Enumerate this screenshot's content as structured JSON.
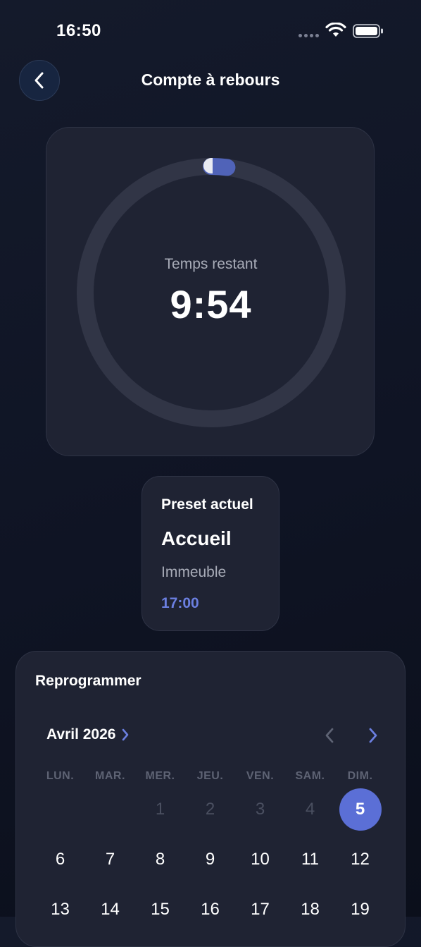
{
  "status_bar": {
    "time": "16:50"
  },
  "nav": {
    "title": "Compte à rebours"
  },
  "timer": {
    "label": "Temps restant",
    "value": "9:54",
    "progress": 0.02
  },
  "preset": {
    "heading": "Preset actuel",
    "name": "Accueil",
    "location": "Immeuble",
    "time": "17:00"
  },
  "schedule": {
    "heading": "Reprogrammer",
    "month": "Avril 2026",
    "weekdays": [
      "LUN.",
      "MAR.",
      "MER.",
      "JEU.",
      "VEN.",
      "SAM.",
      "DIM."
    ],
    "week1": [
      "",
      "",
      "1",
      "2",
      "3",
      "4",
      "5"
    ],
    "week2": [
      "6",
      "7",
      "8",
      "9",
      "10",
      "11",
      "12"
    ],
    "week3": [
      "13",
      "14",
      "15",
      "16",
      "17",
      "18",
      "19"
    ],
    "selected_day": "5"
  },
  "colors": {
    "accent": "#5b6fd6",
    "card": "#1f2333",
    "background": "#10152a"
  }
}
